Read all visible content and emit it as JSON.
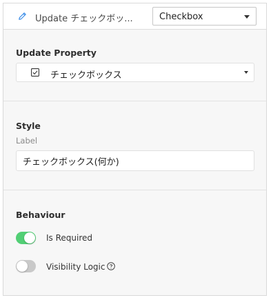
{
  "header": {
    "title": "Update チェックボッ...",
    "type_select": {
      "value": "Checkbox"
    },
    "icon": "pencil-icon"
  },
  "update_property": {
    "title": "Update Property",
    "select": {
      "value": "チェックボックス",
      "icon": "checkbox-icon"
    }
  },
  "style": {
    "title": "Style",
    "label_caption": "Label",
    "label_value": "チェックボックス(何か)"
  },
  "behaviour": {
    "title": "Behaviour",
    "is_required": {
      "label": "Is Required",
      "enabled": true
    },
    "visibility_logic": {
      "label": "Visibility Logic",
      "enabled": false,
      "help_icon": "help-circle-icon"
    }
  },
  "colors": {
    "toggle_on": "#52cf75",
    "toggle_off": "#c9c9c9",
    "accent_icon": "#3d8ee8"
  }
}
